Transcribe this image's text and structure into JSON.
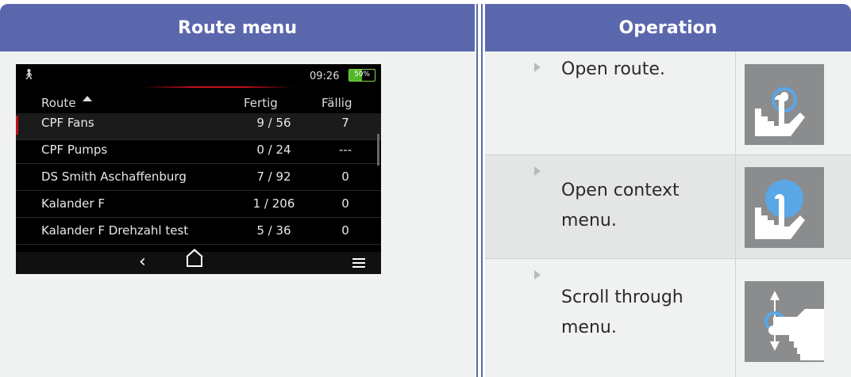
{
  "headers": {
    "left": "Route menu",
    "right": "Operation"
  },
  "screen": {
    "time": "09:26",
    "battery": "50%",
    "columns": {
      "route": "Route",
      "done": "Fertig",
      "due": "Fällig"
    },
    "rows": [
      {
        "name": "CPF Fans",
        "done": "9 / 56",
        "due": "7"
      },
      {
        "name": "CPF Pumps",
        "done": "0 / 24",
        "due": "---"
      },
      {
        "name": "DS Smith Aschaffenburg",
        "done": "7 / 92",
        "due": "0"
      },
      {
        "name": "Kalander F",
        "done": "1 / 206",
        "due": "0"
      },
      {
        "name": "Kalander F Drehzahl test",
        "done": "5 / 36",
        "due": "0"
      }
    ],
    "nav": {
      "back_icon": "back-chevron-icon",
      "home_icon": "home-icon",
      "menu_icon": "hamburger-menu-icon"
    }
  },
  "operations": [
    {
      "line1": "Open route.",
      "line2": "",
      "icon": "tap-gesture-icon"
    },
    {
      "line1": "Open context",
      "line2": "menu.",
      "icon": "long-press-gesture-icon"
    },
    {
      "line1": "Scroll through",
      "line2": "menu.",
      "icon": "scroll-gesture-icon"
    }
  ],
  "colors": {
    "header": "#5b67ad",
    "accent": "#c0101c",
    "touch": "#5aa7e8",
    "battery": "#4fb82a"
  }
}
